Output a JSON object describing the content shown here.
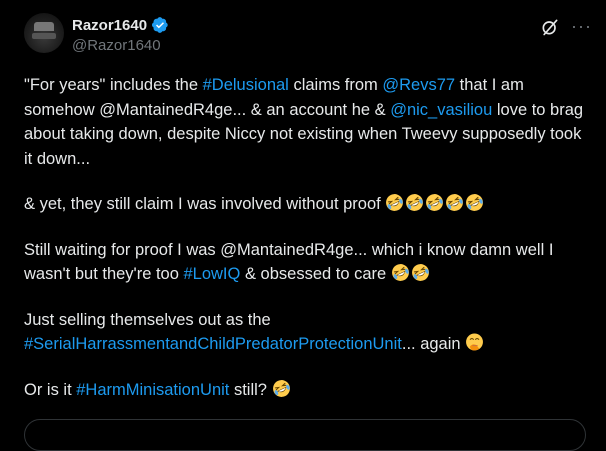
{
  "author": {
    "display_name": "Razor1640",
    "handle": "@Razor1640"
  },
  "icons": {
    "verified": "verified-badge-icon",
    "grok": "grok-icon",
    "more": "more-icon",
    "emoji": "rolling-on-floor-laughing-emoji",
    "hand_over_mouth": "face-with-hand-over-mouth-emoji"
  },
  "colors": {
    "background": "#000000",
    "text": "#e7e9ea",
    "muted": "#71767b",
    "link": "#1d9bf0",
    "verified": "#1d9bf0"
  },
  "more_label": "···",
  "tweet": {
    "p1": {
      "t1": "\"For years\" includes the ",
      "tag_delusional": "#Delusional",
      "t2": " claims from ",
      "mention_revs": "@Revs77",
      "t3": " that I am somehow @MantainedR4ge... & an account he & ",
      "mention_nic": "@nic_vasiliou",
      "t4": " love to brag about taking down, despite Niccy not existing when Tweevy supposedly took it down..."
    },
    "p2": {
      "t1": "& yet, they still claim I was involved without proof "
    },
    "p3": {
      "t1": "Still waiting for proof I was @MantainedR4ge... which i know damn well I wasn't but they're too ",
      "tag_lowiq": "#LowIQ",
      "t2": " & obsessed to care "
    },
    "p4": {
      "t1": "Just selling themselves out as the ",
      "tag_serial": "#SerialHarrassmentandChildPredatorProtectionUnit",
      "t2": "... again "
    },
    "p5": {
      "t1": "Or is it ",
      "tag_harm": "#HarmMinisationUnit",
      "t2": " still? "
    }
  }
}
